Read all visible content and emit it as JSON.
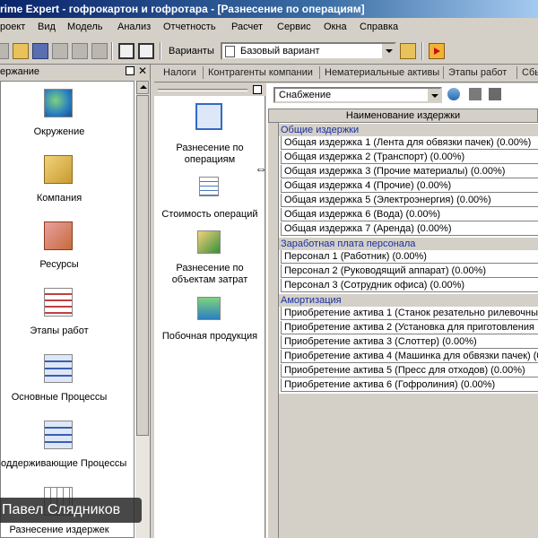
{
  "window": {
    "title": "rime Expert - гофрокартон и гофротара - [Разнесение по операциям]"
  },
  "menu": [
    "роект",
    "Вид",
    "Модель",
    "Анализ",
    "Отчетность",
    "Расчет",
    "Сервис",
    "Окна",
    "Справка"
  ],
  "toolbar": {
    "variants_label": "Варианты",
    "variant_value": "Базовый вариант"
  },
  "left_panel": {
    "header": "ержание",
    "items": [
      {
        "label": "Окружение",
        "icon": "globe-icon"
      },
      {
        "label": "Компания",
        "icon": "pyramid-icon"
      },
      {
        "label": "Ресурсы",
        "icon": "boxes-icon"
      },
      {
        "label": "Этапы работ",
        "icon": "gantt-icon"
      },
      {
        "label": "Основные Процессы",
        "icon": "process-icon"
      },
      {
        "label": "оддерживающие Процессы",
        "icon": "process-icon"
      },
      {
        "label": "Разнесение издержек",
        "icon": "table-icon"
      }
    ]
  },
  "tabs": [
    "Налоги",
    "Контрагенты компании",
    "Нематериальные активы",
    "Этапы работ",
    "Сбы"
  ],
  "middle_panel": {
    "items": [
      {
        "label": "Разнесение по операциям",
        "icon": "allocation-icon",
        "selected": true
      },
      {
        "label": "Стоимость операций",
        "icon": "calculator-icon",
        "selected": false
      },
      {
        "label": "Разнесение по объектам затрат",
        "icon": "cost-objects-icon",
        "selected": false
      },
      {
        "label": "Побочная продукция",
        "icon": "byproduct-icon",
        "selected": false
      }
    ]
  },
  "right_panel": {
    "filter_value": "Снабжение",
    "column_header": "Наименование издержки",
    "groups": [
      {
        "name": "Общие издержки",
        "rows": [
          "Общая издержка 1 (Лента для обвязки пачек) (0.00%)",
          "Общая издержка 2 (Транспорт) (0.00%)",
          "Общая издержка 3 (Прочие материалы) (0.00%)",
          "Общая издержка 4 (Прочие) (0.00%)",
          "Общая издержка 5 (Электроэнергия) (0.00%)",
          "Общая издержка 6 (Вода) (0.00%)",
          "Общая издержка 7 (Аренда) (0.00%)"
        ]
      },
      {
        "name": "Заработная плата персонала",
        "rows": [
          "Персонал 1 (Работник) (0.00%)",
          "Персонал 2 (Руководящий аппарат) (0.00%)",
          "Персонал 3 (Сотрудник офиса) (0.00%)"
        ]
      },
      {
        "name": "Амортизация",
        "rows": [
          "Приобретение актива 1 (Станок резательно рилевочный",
          "Приобретение актива 2 (Установка для приготовления",
          "Приобретение актива 3 (Слоттер) (0.00%)",
          "Приобретение актива 4 (Машинка для обвязки пачек) (0",
          "Приобретение актива 5 (Пресс для отходов) (0.00%)",
          "Приобретение актива 6 (Гофролиния) (0.00%)"
        ]
      }
    ]
  },
  "watermark": "Павел Слядников",
  "colors": {
    "group_text": "#1a2fa0",
    "selection": "#316ac5",
    "titlebar": "#0a246a"
  }
}
